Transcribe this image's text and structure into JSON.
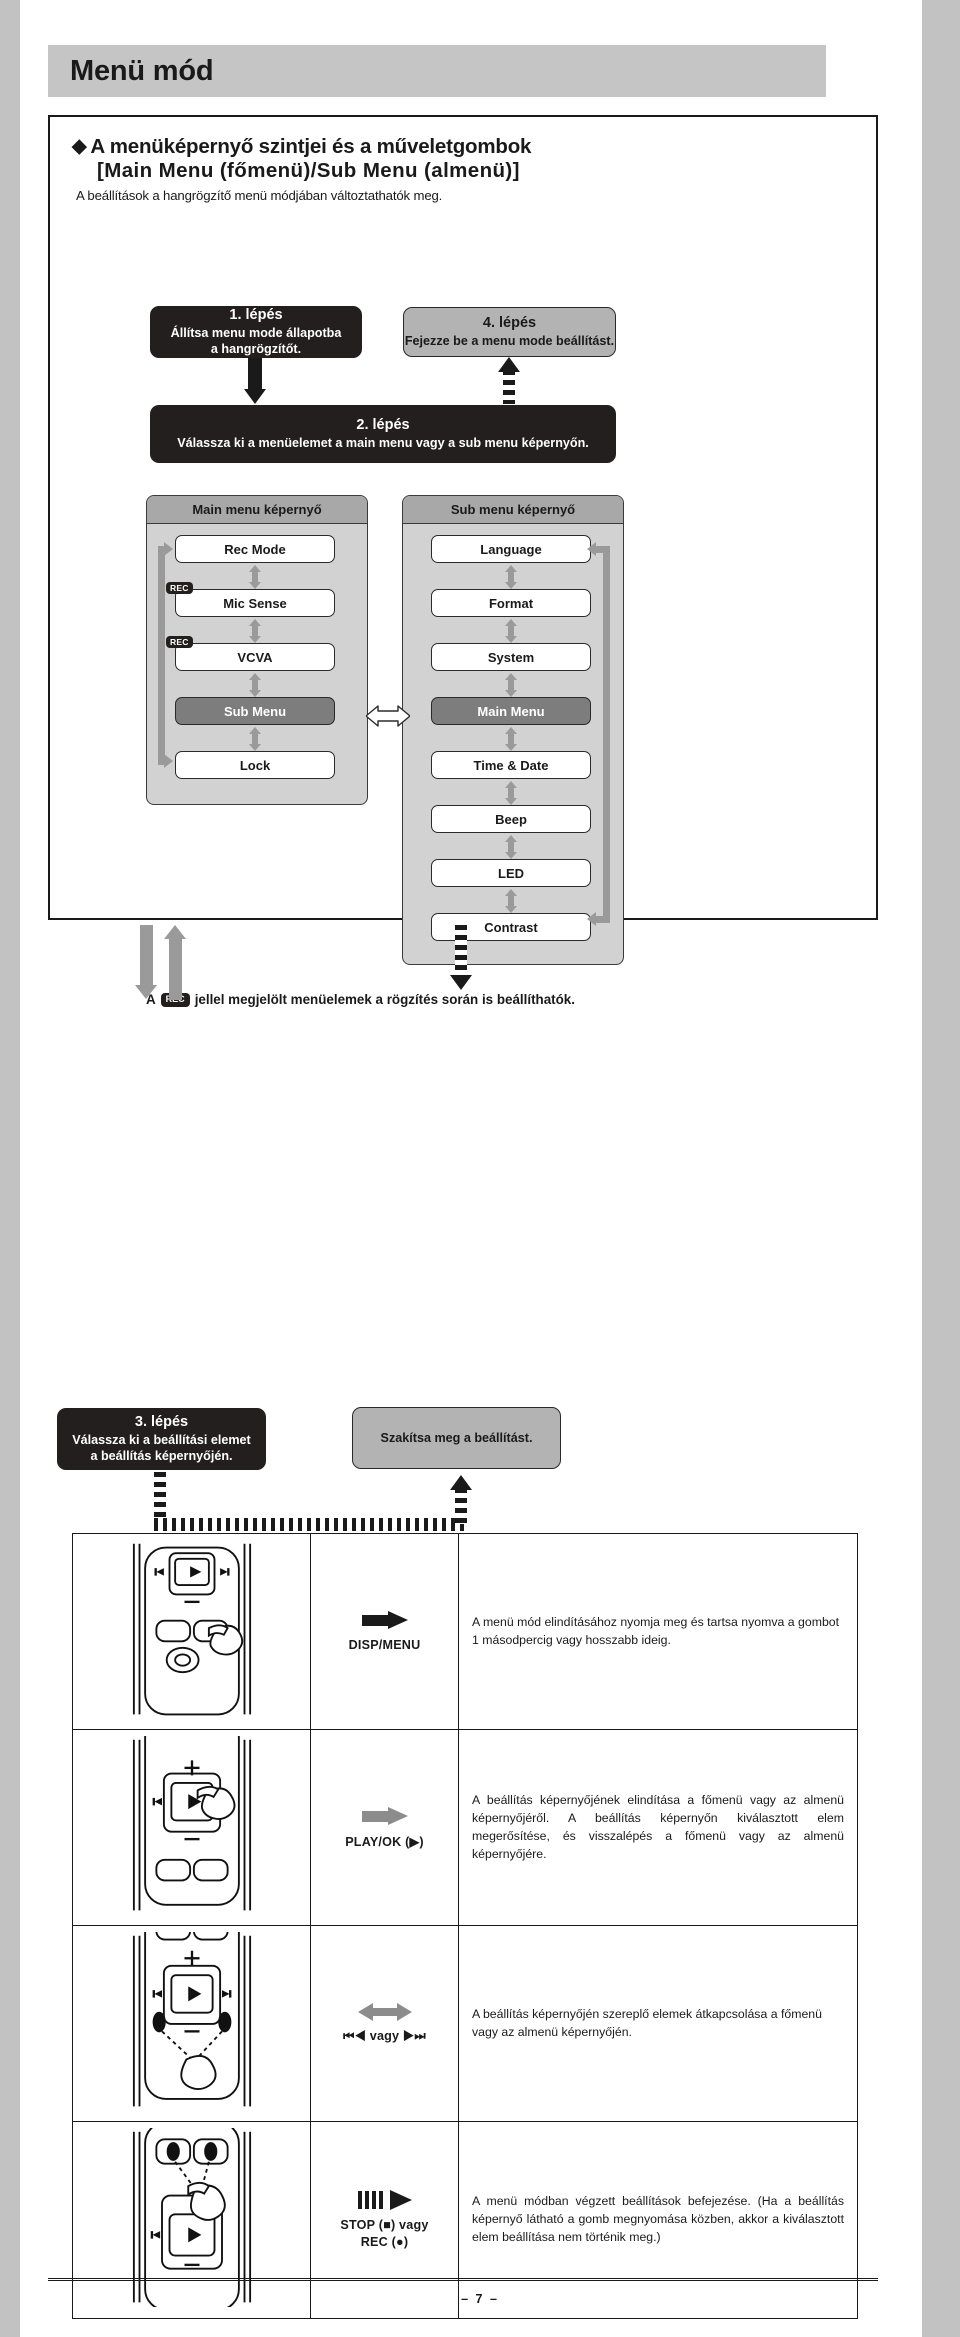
{
  "page": {
    "title": "Menü mód",
    "footer": "– 7 –"
  },
  "section": {
    "bullet": "◆",
    "heading_line1": "A menüképernyő szintjei és a műveletgombok",
    "heading_line2": "[Main Menu (főmenü)/Sub Menu (almenü)]",
    "subheading": "A beállítások a hangrögzítő menü módjában változtathatók meg."
  },
  "steps": {
    "step1": {
      "num": "1. lépés",
      "text": "Állítsa menu mode állapotba\na hangrögzítőt."
    },
    "step2": {
      "num": "2. lépés",
      "text": "Válassza ki a menüelemet a main menu vagy a sub menu képernyőn."
    },
    "step3": {
      "num": "3. lépés",
      "text": "Válassza ki a beállítási elemet\na beállítás képernyőjén."
    },
    "step4": {
      "num": "4. lépés",
      "text": "Fejezze be a menu mode beállítást."
    },
    "abort": {
      "num": "",
      "text": "Szakítsa meg a beállítást."
    }
  },
  "screens": {
    "main": {
      "header": "Main menu képernyő",
      "items": [
        {
          "label": "Rec Mode",
          "rec": false,
          "highlight": false
        },
        {
          "label": "Mic Sense",
          "rec": true,
          "highlight": false
        },
        {
          "label": "VCVA",
          "rec": true,
          "highlight": false
        },
        {
          "label": "Sub Menu",
          "rec": false,
          "highlight": true
        },
        {
          "label": "Lock",
          "rec": false,
          "highlight": false
        }
      ]
    },
    "sub": {
      "header": "Sub menu képernyő",
      "items": [
        {
          "label": "Language",
          "rec": false,
          "highlight": false
        },
        {
          "label": "Format",
          "rec": false,
          "highlight": false
        },
        {
          "label": "System",
          "rec": false,
          "highlight": false
        },
        {
          "label": "Main Menu",
          "rec": false,
          "highlight": true
        },
        {
          "label": "Time & Date",
          "rec": false,
          "highlight": false
        },
        {
          "label": "Beep",
          "rec": false,
          "highlight": false
        },
        {
          "label": "LED",
          "rec": false,
          "highlight": false
        },
        {
          "label": "Contrast",
          "rec": false,
          "highlight": false
        }
      ]
    },
    "rec_badge_label": "REC"
  },
  "note": {
    "prefix": "A",
    "badge": "REC",
    "suffix": "jellel megjelölt menüelemek a rögzítés során is beállíthatók."
  },
  "button_table": {
    "rows": [
      {
        "button_label": "DISP/MENU",
        "button_sub": "",
        "arrow": "solid-black-right",
        "description": "A menü mód elindításához nyomja meg és tartsa nyomva a gombot 1 másodpercig vagy hosszabb ideig."
      },
      {
        "button_label": "PLAY/OK (▶)",
        "button_sub": "",
        "arrow": "solid-gray-right",
        "description": "A beállítás képernyőjének elindítása a főmenü vagy az almenü képernyőjéről. A beállítás képernyőn kiválasztott elem megerősítése, és visszalépés a főmenü vagy az almenü képernyőjére."
      },
      {
        "button_label": "⏮◀ vagy ▶⏭",
        "button_sub": "",
        "arrow": "gray-double",
        "description": "A beállítás képernyőjén szereplő elemek átkapcsolása a főmenü vagy az almenü képernyőjén."
      },
      {
        "button_label": "STOP (■) vagy",
        "button_sub": "REC (●)",
        "arrow": "striped-black-right",
        "description": "A menü módban végzett beállítások befejezése. (Ha a beállítás képernyő látható a gomb megnyomása közben, akkor a kiválasztott elem beállítása nem történik meg.)"
      }
    ]
  },
  "colors": {
    "gutter": "#c2c2c2",
    "title_band": "#c5c5c5",
    "dark_box": "#231f1f",
    "gray_box": "#b3b3b3",
    "screen_bg": "#d2d2d2",
    "screen_hdr": "#a8a8a8",
    "item_highlight": "#7d7d7d",
    "arrow_gray": "#9a9a9a"
  }
}
